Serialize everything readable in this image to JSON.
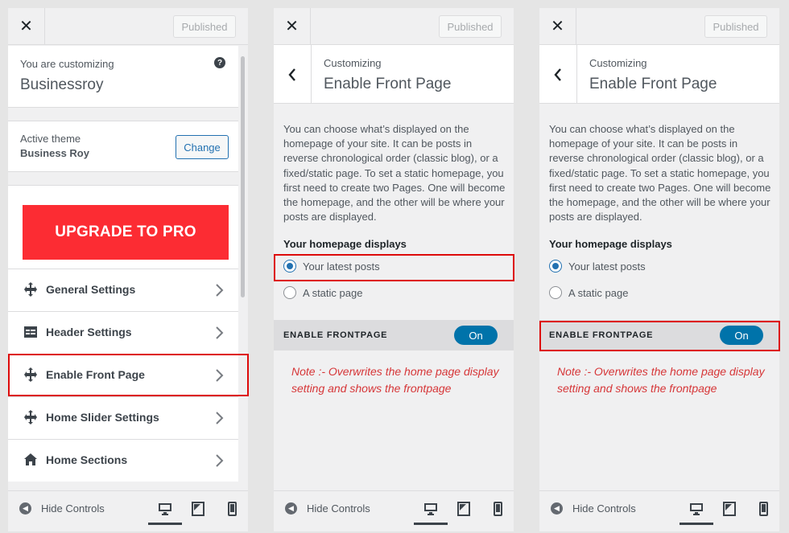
{
  "panel1": {
    "published_label": "Published",
    "customizing_label": "You are customizing",
    "site_name": "Businessroy",
    "help_symbol": "?",
    "active_theme_label": "Active theme",
    "theme_name": "Business Roy",
    "change_label": "Change",
    "upgrade_label": "UPGRADE TO PRO",
    "menu": [
      {
        "label": "General Settings",
        "icon": "move-icon"
      },
      {
        "label": "Header Settings",
        "icon": "header-icon"
      },
      {
        "label": "Enable Front Page",
        "icon": "move-icon"
      },
      {
        "label": "Home Slider Settings",
        "icon": "move-icon"
      },
      {
        "label": "Home Sections",
        "icon": "home-icon"
      }
    ],
    "hide_controls": "Hide Controls"
  },
  "section": {
    "published_label": "Published",
    "customizing_label": "Customizing",
    "title": "Enable Front Page",
    "description": "You can choose what’s displayed on the homepage of your site. It can be posts in reverse chronological order (classic blog), or a fixed/static page. To set a static homepage, you first need to create two Pages. One will become the homepage, and the other will be where your posts are displayed.",
    "homepage_displays_label": "Your homepage displays",
    "option_latest": "Your latest posts",
    "option_static": "A static page",
    "enable_label": "ENABLE FRONTPAGE",
    "toggle_label": "On",
    "note": "Note :- Overwrites the home page display setting and shows the frontpage",
    "hide_controls": "Hide Controls"
  },
  "colors": {
    "accent": "#2271b1",
    "upgrade": "#fc2c33",
    "highlight": "#dd0a0a",
    "note": "#d63638"
  }
}
